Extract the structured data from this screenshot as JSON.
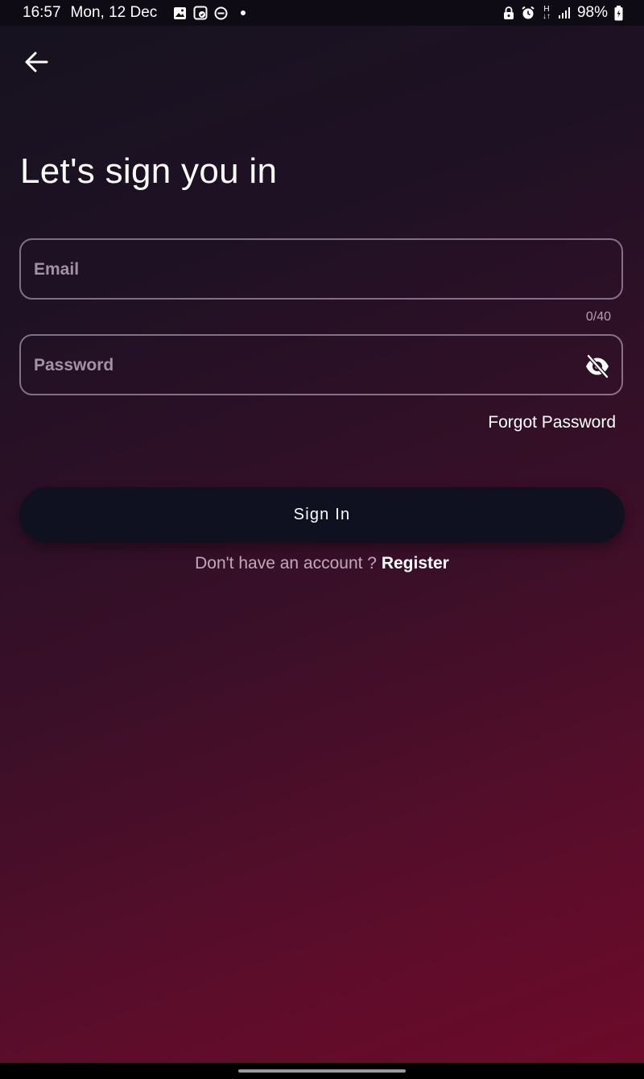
{
  "status_bar": {
    "time": "16:57",
    "date": "Mon, 12 Dec",
    "battery": "98%",
    "network_type": "H",
    "left_icons": [
      "gallery-icon",
      "screenshot-icon",
      "do-not-disturb-icon",
      "notification-dot-icon"
    ],
    "right_icons": [
      "lock-icon",
      "alarm-icon",
      "network-type-icon",
      "signal-icon",
      "battery-icon"
    ]
  },
  "header": {
    "back_icon": "arrow-left-icon"
  },
  "main": {
    "title": "Let's sign you in",
    "email": {
      "value": "",
      "placeholder": "Email",
      "counter": "0/40"
    },
    "password": {
      "value": "",
      "placeholder": "Password",
      "visibility_icon": "eye-off-icon"
    },
    "forgot_password_label": "Forgot Password",
    "sign_in_label": "Sign In",
    "register_prompt": "Don't have an account ?",
    "register_label": "Register"
  },
  "colors": {
    "background_top": "#16121f",
    "background_bottom": "#6e0a2a",
    "button_bg": "#0f1020",
    "text": "#ffffff"
  }
}
